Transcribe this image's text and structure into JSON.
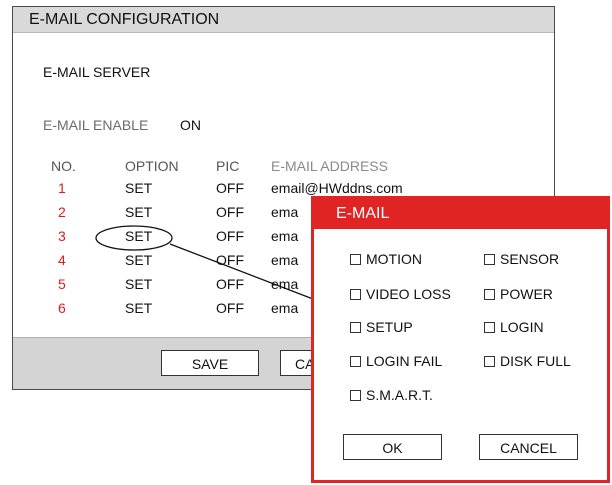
{
  "window": {
    "title": "E-MAIL CONFIGURATION"
  },
  "server": {
    "section_title": "E-MAIL SERVER",
    "enable_label": "E-MAIL ENABLE",
    "enable_value": "ON"
  },
  "table": {
    "headers": {
      "no": "NO.",
      "option": "OPTION",
      "pic": "PIC",
      "address": "E-MAIL ADDRESS"
    },
    "rows": [
      {
        "no": "1",
        "option": "SET",
        "pic": "OFF",
        "address": "email@HWddns.com"
      },
      {
        "no": "2",
        "option": "SET",
        "pic": "OFF",
        "address": "ema"
      },
      {
        "no": "3",
        "option": "SET",
        "pic": "OFF",
        "address": "ema"
      },
      {
        "no": "4",
        "option": "SET",
        "pic": "OFF",
        "address": "ema"
      },
      {
        "no": "5",
        "option": "SET",
        "pic": "OFF",
        "address": "ema"
      },
      {
        "no": "6",
        "option": "SET",
        "pic": "OFF",
        "address": "ema"
      }
    ]
  },
  "footer": {
    "save_label": "SAVE",
    "cancel_label": "CA"
  },
  "popup": {
    "title": "E-MAIL",
    "options": {
      "motion": "MOTION",
      "sensor": "SENSOR",
      "video_loss": "VIDEO LOSS",
      "power": "POWER",
      "setup": "SETUP",
      "login": "LOGIN",
      "login_fail": "LOGIN FAIL",
      "disk_full": "DISK FULL",
      "smart": "S.M.A.R.T."
    },
    "ok_label": "OK",
    "cancel_label": "CANCEL"
  },
  "colors": {
    "accent": "#e02323",
    "row_number": "#e01b1b",
    "title_bar": "#d9d9d9",
    "footer_bar": "#d4d4d4"
  }
}
